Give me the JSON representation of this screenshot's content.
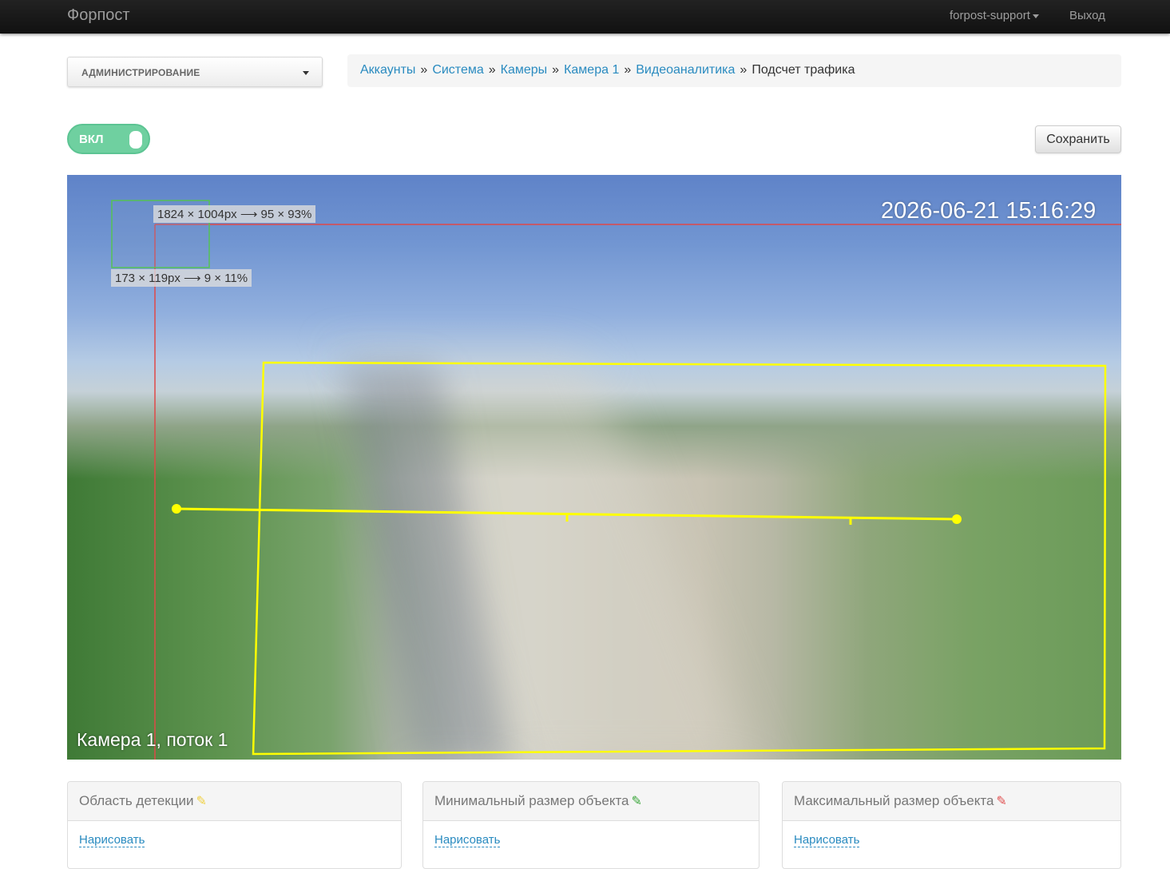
{
  "navbar": {
    "brand": "Форпост",
    "user": "forpost-support",
    "logout": "Выход"
  },
  "admin_dropdown": {
    "label": "АДМИНИСТРИРОВАНИЕ"
  },
  "breadcrumb": {
    "items": [
      "Аккаунты",
      "Система",
      "Камеры",
      "Камера 1",
      "Видеоаналитика"
    ],
    "current": "Подсчет трафика",
    "separator": "»"
  },
  "toggle": {
    "label": "ВКЛ",
    "state": "on",
    "color": "#6fd0a0"
  },
  "save_button": {
    "label": "Сохранить"
  },
  "camera": {
    "timestamp": "2026-06-21 15:16:29",
    "caption": "Камера 1, поток 1",
    "max_size_label": "1824 × 1004px  ⟶  95 × 93%",
    "min_size_label": "173 × 119px  ⟶  9 × 11%",
    "overlay_colors": {
      "detection_zone": "#ffff00",
      "max_size_frame": "#e04848",
      "min_size_frame": "#55c255"
    }
  },
  "panels": [
    {
      "title": "Область детекции",
      "icon": "edit-icon",
      "icon_color": "#f0d040",
      "link": "Нарисовать"
    },
    {
      "title": "Минимальный размер объекта",
      "icon": "edit-icon",
      "icon_color": "#3aa63a",
      "link": "Нарисовать"
    },
    {
      "title": "Максимальный размер объекта",
      "icon": "edit-icon",
      "icon_color": "#e05050",
      "link": "Нарисовать"
    }
  ]
}
